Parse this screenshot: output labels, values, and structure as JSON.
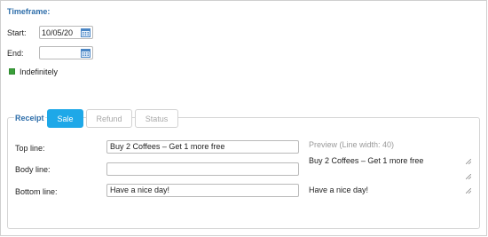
{
  "timeframe": {
    "title": "Timeframe:",
    "start_label": "Start:",
    "start_value": "10/05/20",
    "end_label": "End:",
    "end_value": "",
    "indefinitely_label": "Indefinitely",
    "indefinitely_checked": true
  },
  "receipt": {
    "label": "Receipt",
    "tabs": [
      {
        "label": "Sale",
        "active": true
      },
      {
        "label": "Refund",
        "active": false
      },
      {
        "label": "Status",
        "active": false
      }
    ],
    "rows": [
      {
        "label": "Top line:",
        "value": "Buy 2 Coffees – Get 1 more free"
      },
      {
        "label": "Body line:",
        "value": ""
      },
      {
        "label": "Bottom line:",
        "value": "Have a nice day!"
      }
    ],
    "preview": {
      "title": "Preview (Line width: 40)",
      "top_text": "Buy 2 Coffees – Get 1 more free",
      "body_text": "",
      "bottom_text": "Have a nice day!"
    }
  },
  "icons": {
    "calendar": "calendar-icon",
    "resize": "resize-grip-icon"
  },
  "colors": {
    "accent_blue": "#2e6eaa",
    "active_tab": "#1ea8e8",
    "checkbox_green": "#3a9f3a",
    "preview_title": "#9a9a9a",
    "border": "#b9b9b9"
  }
}
